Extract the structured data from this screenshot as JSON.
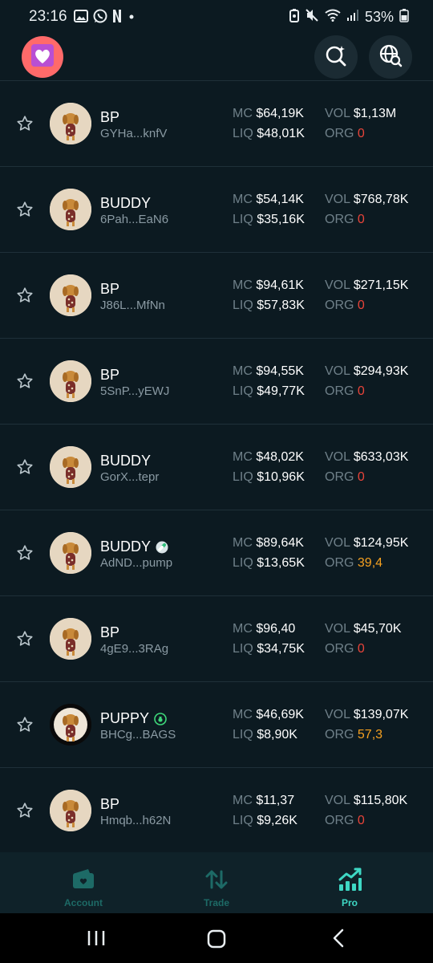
{
  "statusbar": {
    "time": "23:16",
    "left_icons": [
      "image-icon",
      "whatsapp-icon",
      "netflix-icon",
      "dot-icon"
    ],
    "right_icons": [
      "battery-saver-icon",
      "mute-icon",
      "wifi-icon",
      "signal-icon"
    ],
    "battery": "53%"
  },
  "header": {
    "logo_icon": "heart-icon",
    "search_icon": "search-sparkle-icon",
    "globe_icon": "globe-search-icon"
  },
  "tokens": [
    {
      "name": "BP",
      "address": "GYHa...knfV",
      "mc_label": "MC",
      "mc": "$64,19K",
      "liq_label": "LIQ",
      "liq": "$48,01K",
      "vol_label": "VOL",
      "vol": "$1,13M",
      "org_label": "ORG",
      "org": "0",
      "org_color": "red"
    },
    {
      "name": "BUDDY",
      "address": "6Pah...EaN6",
      "mc_label": "MC",
      "mc": "$54,14K",
      "liq_label": "LIQ",
      "liq": "$35,16K",
      "vol_label": "VOL",
      "vol": "$768,78K",
      "org_label": "ORG",
      "org": "0",
      "org_color": "red"
    },
    {
      "name": "BP",
      "address": "J86L...MfNn",
      "mc_label": "MC",
      "mc": "$94,61K",
      "liq_label": "LIQ",
      "liq": "$57,83K",
      "vol_label": "VOL",
      "vol": "$271,15K",
      "org_label": "ORG",
      "org": "0",
      "org_color": "red"
    },
    {
      "name": "BP",
      "address": "5SnP...yEWJ",
      "mc_label": "MC",
      "mc": "$94,55K",
      "liq_label": "LIQ",
      "liq": "$49,77K",
      "vol_label": "VOL",
      "vol": "$294,93K",
      "org_label": "ORG",
      "org": "0",
      "org_color": "red"
    },
    {
      "name": "BUDDY",
      "address": "GorX...tepr",
      "mc_label": "MC",
      "mc": "$48,02K",
      "liq_label": "LIQ",
      "liq": "$10,96K",
      "vol_label": "VOL",
      "vol": "$633,03K",
      "org_label": "ORG",
      "org": "0",
      "org_color": "red"
    },
    {
      "name": "BUDDY",
      "address": "AdND...pump",
      "badge": "pill-icon",
      "mc_label": "MC",
      "mc": "$89,64K",
      "liq_label": "LIQ",
      "liq": "$13,65K",
      "vol_label": "VOL",
      "vol": "$124,95K",
      "org_label": "ORG",
      "org": "39,4",
      "org_color": "orange"
    },
    {
      "name": "BP",
      "address": "4gE9...3RAg",
      "mc_label": "MC",
      "mc": "$96,40",
      "liq_label": "LIQ",
      "liq": "$34,75K",
      "vol_label": "VOL",
      "vol": "$45,70K",
      "org_label": "ORG",
      "org": "0",
      "org_color": "red"
    },
    {
      "name": "PUPPY",
      "address": "BHCg...BAGS",
      "badge": "money-bag-icon",
      "mc_label": "MC",
      "mc": "$46,69K",
      "liq_label": "LIQ",
      "liq": "$8,90K",
      "vol_label": "VOL",
      "vol": "$139,07K",
      "org_label": "ORG",
      "org": "57,3",
      "org_color": "orange"
    },
    {
      "name": "BP",
      "address": "Hmqb...h62N",
      "mc_label": "MC",
      "mc": "$11,37",
      "liq_label": "LIQ",
      "liq": "$9,26K",
      "vol_label": "VOL",
      "vol": "$115,80K",
      "org_label": "ORG",
      "org": "0",
      "org_color": "red"
    }
  ],
  "bottom_nav": [
    {
      "label": "Account",
      "icon": "wallet-icon",
      "active": false
    },
    {
      "label": "Trade",
      "icon": "swap-arrows-icon",
      "active": false
    },
    {
      "label": "Pro",
      "icon": "chart-trend-icon",
      "active": true
    }
  ],
  "colors": {
    "background": "#0c1a21",
    "accent": "#3ed8c4",
    "org_red": "#e8443a",
    "org_orange": "#f5a020"
  }
}
